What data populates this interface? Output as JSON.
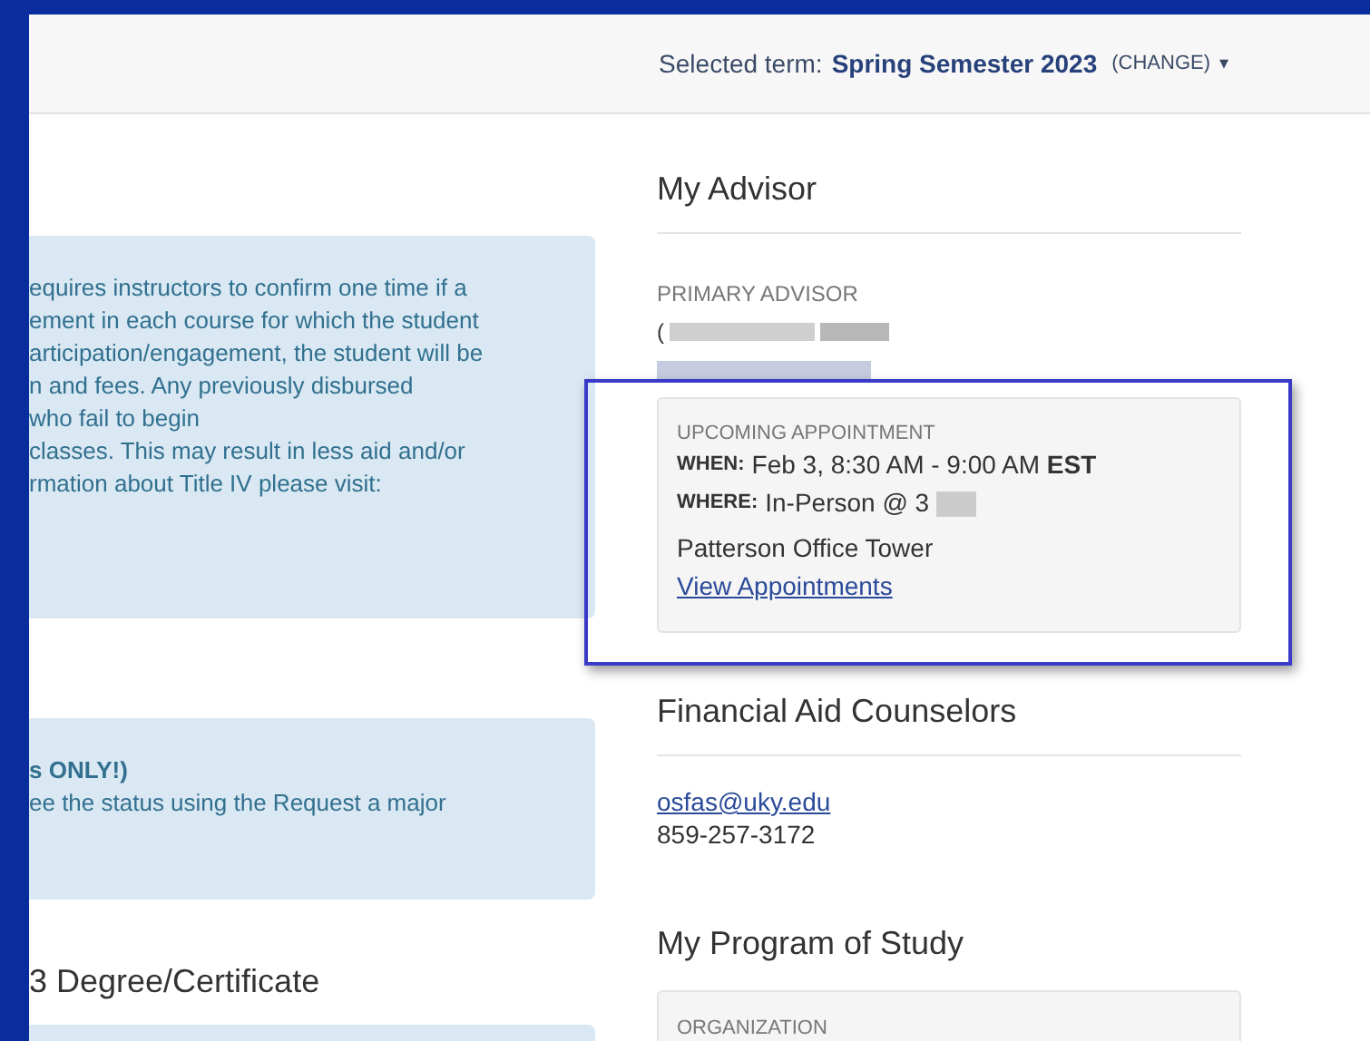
{
  "header": {
    "label": "Selected term:",
    "term": "Spring Semester 2023",
    "change": "(CHANGE)",
    "caret": "▾"
  },
  "left": {
    "notice_lines": [
      "equires instructors to confirm one time if a",
      "ement in each course for which the student",
      "articipation/engagement, the student will be",
      "n and fees. Any previously disbursed",
      "who fail to begin",
      "classes. This may result in less aid and/or",
      "rmation about Title IV please visit:"
    ],
    "major_notice": {
      "title": "s ONLY!)",
      "text": "ee the status using the Request a major"
    },
    "degree_heading": "3 Degree/Certificate"
  },
  "advisor": {
    "heading": "My Advisor",
    "label": "PRIMARY ADVISOR",
    "name_start": "(",
    "appointment": {
      "label": "UPCOMING APPOINTMENT",
      "when_label": "WHEN:",
      "when": "Feb 3, 8:30 AM - 9:00 AM **EST**",
      "where_label": "WHERE:",
      "where_start": "In-Person @ 3",
      "where_end": "Patterson Office Tower",
      "link": "View Appointments"
    }
  },
  "counselors": {
    "heading": "Financial Aid Counselors",
    "email": "osfas@uky.edu",
    "phone": "859-257-3172"
  },
  "program": {
    "heading": "My Program of Study",
    "label": "ORGANIZATION"
  }
}
